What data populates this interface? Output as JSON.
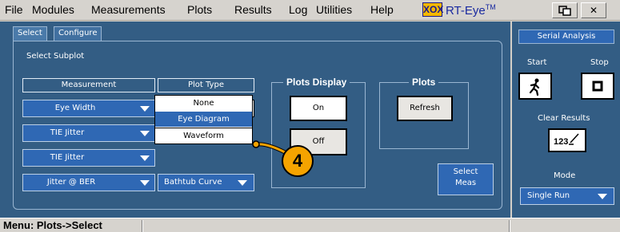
{
  "menu": {
    "items": [
      "File",
      "Modules",
      "Measurements",
      "Plots",
      "Results",
      "Log",
      "Utilities",
      "Help"
    ]
  },
  "brand": {
    "logo_box": "XOX",
    "name": "RT-Eye",
    "tm": "TM"
  },
  "tabs": {
    "select": "Select",
    "configure": "Configure"
  },
  "subplot": {
    "heading": "Select Subplot",
    "col_measurement": "Measurement",
    "col_plot_type": "Plot Type",
    "rows": [
      {
        "measurement": "Eye Width",
        "plot_type": "Eye Diagram"
      },
      {
        "measurement": "TIE Jitter",
        "plot_type": ""
      },
      {
        "measurement": "TIE Jitter",
        "plot_type": ""
      },
      {
        "measurement": "Jitter @ BER",
        "plot_type": "Bathtub Curve"
      }
    ],
    "dropdown_options": [
      "None",
      "Eye Diagram",
      "Waveform"
    ],
    "selected_option": "Eye Diagram"
  },
  "plots_display": {
    "title": "Plots Display",
    "on_label": "On",
    "off_label": "Off"
  },
  "plots": {
    "title": "Plots",
    "refresh_label": "Refresh"
  },
  "select_meas": {
    "line1": "Select",
    "line2": "Meas"
  },
  "callout": {
    "number": "4",
    "color": "#f5a300"
  },
  "right_panel": {
    "title": "Serial Analysis",
    "start_label": "Start",
    "stop_label": "Stop",
    "clear_results_label": "Clear Results",
    "clear_icon_text": "123",
    "mode_label": "Mode",
    "mode_value": "Single Run"
  },
  "status": {
    "text": "Menu: Plots->Select"
  },
  "colors": {
    "panel": "#335d84",
    "accent": "#2f68b4",
    "callout": "#f5a300"
  }
}
